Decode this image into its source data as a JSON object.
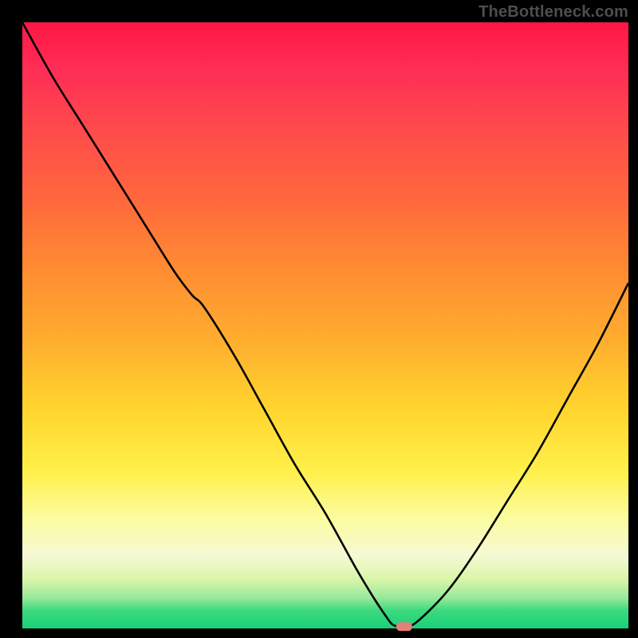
{
  "watermark": "TheBottleneck.com",
  "chart_data": {
    "type": "line",
    "title": "",
    "xlabel": "",
    "ylabel": "",
    "xlim": [
      0,
      100
    ],
    "ylim": [
      0,
      100
    ],
    "grid": false,
    "legend": false,
    "background": "rainbow-gradient (red top to green bottom)",
    "series": [
      {
        "name": "bottleneck-curve",
        "x": [
          0,
          5,
          10,
          15,
          20,
          25,
          28,
          30,
          35,
          40,
          45,
          50,
          55,
          58,
          60,
          61,
          62,
          63,
          65,
          70,
          75,
          80,
          85,
          90,
          95,
          100
        ],
        "y": [
          100,
          91,
          83,
          75,
          67,
          59,
          55,
          53,
          45,
          36,
          27,
          19,
          10,
          5,
          2,
          0.7,
          0.3,
          0.3,
          1,
          6,
          13,
          21,
          29,
          38,
          47,
          57
        ]
      }
    ],
    "marker": {
      "x": 63,
      "y": 0.3,
      "label": "optimal-point"
    }
  }
}
